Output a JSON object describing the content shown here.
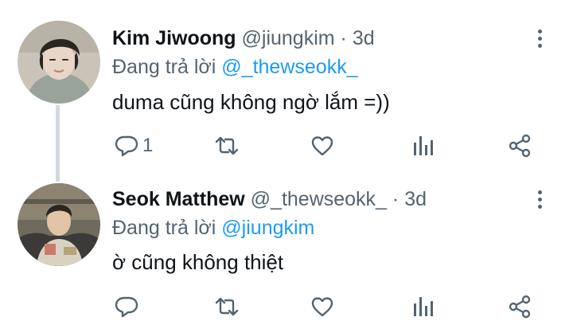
{
  "tweets": [
    {
      "author_name": "Kim Jiwoong",
      "handle": "@jiungkim",
      "separator": "·",
      "time": "3d",
      "reply_prefix": "Đang trả lời",
      "reply_to": "@_thewseokk_",
      "text": "duma cũng không ngờ lắm =))",
      "reply_count": "1",
      "icons": {
        "reply": "reply-bubble-icon",
        "retweet": "retweet-icon",
        "like": "heart-icon",
        "stats": "bar-chart-icon",
        "share": "share-icon",
        "more": "more-vertical-icon"
      }
    },
    {
      "author_name": "Seok Matthew",
      "handle": "@_thewseokk_",
      "separator": "·",
      "time": "3d",
      "reply_prefix": "Đang trả lời",
      "reply_to": "@jiungkim",
      "text": "ờ cũng không thiệt",
      "reply_count": "",
      "icons": {
        "reply": "reply-bubble-icon",
        "retweet": "retweet-icon",
        "like": "heart-icon",
        "stats": "bar-chart-icon",
        "share": "share-icon",
        "more": "more-vertical-icon"
      }
    }
  ],
  "colors": {
    "name": "#0f1419",
    "meta": "#536471",
    "mention": "#1d9bf0",
    "thread_line": "#cfd9de",
    "background": "#ffffff"
  }
}
